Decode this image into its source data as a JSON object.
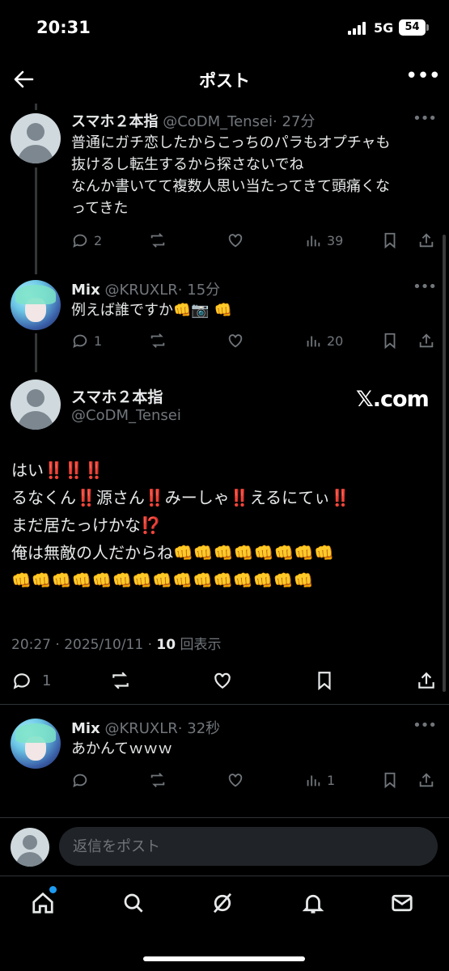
{
  "status_bar": {
    "time": "20:31",
    "network": "5G",
    "battery": "54"
  },
  "header": {
    "title": "ポスト",
    "more": "•••"
  },
  "replies_above": [
    {
      "name": "スマホ２本指",
      "handle": "@CoDM_Tensei",
      "time": "· 27分",
      "text": "普通にガチ恋したからこっちのパラもオプチャも\n抜けるし転生するから探さないでね\nなんか書いてて複数人思い当たってきて頭痛くな\nってきた",
      "replies": "2",
      "views": "39",
      "avatar": "default-avatar"
    },
    {
      "name": "Mix",
      "handle": "@KRUXLR",
      "time": "· 15分",
      "text": "例えば誰ですか👊📷 👊",
      "replies": "1",
      "views": "20",
      "avatar": "anime-avatar"
    }
  ],
  "main_post": {
    "name": "スマホ２本指",
    "handle": "@CoDM_Tensei",
    "watermark": "𝕏.com",
    "text": "はい‼️‼️‼️\nるなくん‼️源さん‼️みーしゃ‼️えるにてぃ‼️\nまだ居たっけかな⁉️\n俺は無敵の人だからね👊👊👊👊👊👊👊👊\n👊👊👊👊👊👊👊👊👊👊👊👊👊👊👊",
    "timestamp": "20:27 · 2025/10/11 · ",
    "view_count": "10",
    "view_label": " 回表示",
    "replies": "1"
  },
  "reply_below": {
    "name": "Mix",
    "handle": "@KRUXLR",
    "time": "· 32秒",
    "text": "あかんてｗｗｗ",
    "views": "1",
    "avatar": "anime-avatar"
  },
  "reply_box": {
    "placeholder": "返信をポスト"
  },
  "tabs": [
    "home-icon",
    "search-icon",
    "grok-icon",
    "notifications-icon",
    "messages-icon"
  ],
  "colors": {
    "background": "#000000",
    "secondary_text": "#71767b",
    "accent": "#1d9bf0"
  }
}
